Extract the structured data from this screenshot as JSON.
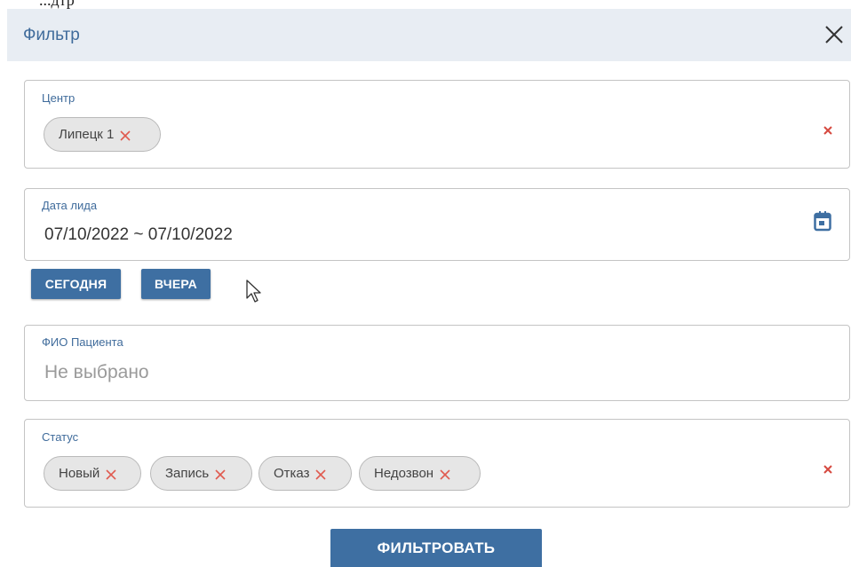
{
  "top_clip_text": "...дтр",
  "dialog": {
    "title": "Фильтр",
    "close_icon": "close-icon"
  },
  "center_field": {
    "label": "Центр",
    "chips": [
      "Липецк 1"
    ],
    "clear_icon": "clear-x-icon"
  },
  "date_field": {
    "label": "Дата лида",
    "value": "07/10/2022 ~ 07/10/2022",
    "icon": "calendar-icon"
  },
  "quick_buttons": {
    "today": "СЕГОДНЯ",
    "yesterday": "ВЧЕРА"
  },
  "patient_field": {
    "label": "ФИО Пациента",
    "placeholder": "Не выбрано"
  },
  "status_field": {
    "label": "Статус",
    "chips": [
      "Новый",
      "Запись",
      "Отказ",
      "Недозвон"
    ],
    "clear_icon": "clear-x-icon"
  },
  "submit": {
    "label": "ФИЛЬТРОВАТЬ"
  },
  "colors": {
    "accent": "#3e6fa2",
    "header_bg": "#e8edf3",
    "title": "#3f6b9b",
    "remove_x": "#e05a4f",
    "chip_bg": "#e6e6e6"
  }
}
